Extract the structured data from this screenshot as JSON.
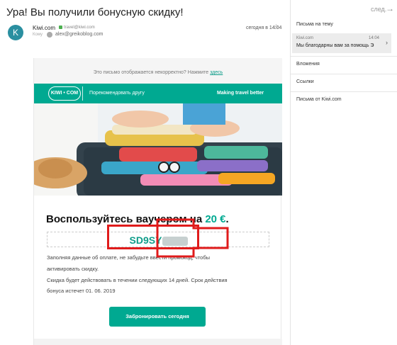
{
  "email": {
    "subject": "Ура! Вы получили бонусную скидку!",
    "next_label": "след.",
    "sender_initial": "K",
    "sender_name": "Kiwi.com",
    "sender_email": "travel@kiwi.com",
    "to_label": "Кому",
    "to_email": "alex@greikoblog.com",
    "date": "сегодня в 14:04"
  },
  "sidebar": {
    "thread_title": "Письма на тему",
    "thread_item_from": "Kiwi.com",
    "thread_item_time": "14:04",
    "thread_item_snippet": "Мы благодарны вам за помощь Э",
    "attachments": "Вложения",
    "links": "Ссылки",
    "letters_from": "Письма от Kiwi.com"
  },
  "newsletter": {
    "bad_display_text": "Это письмо отображается некорректно? Нажмите ",
    "bad_display_link": "здесь",
    "logo_text": "KIWI • COM",
    "recommend": "Порекомендовать другу",
    "tagline": "Making travel better",
    "voucher_text": "Воспользуйтесь ваучером на ",
    "voucher_amount": "20 €",
    "voucher_period": ".",
    "promo_code": "SD9SY",
    "line1": "Заполняя данные об оплате, не забудьте ввести промокод, чтобы",
    "line2": "активировать скидку.",
    "line3": "Скидка будет действовать в течении следующих 14 дней. Срок действия",
    "line4": "бонуса истечет 01. 06. 2019",
    "cta": "Забронировать сегодня"
  },
  "colors": {
    "brand": "#00a991",
    "highlight": "#e01b1b"
  }
}
